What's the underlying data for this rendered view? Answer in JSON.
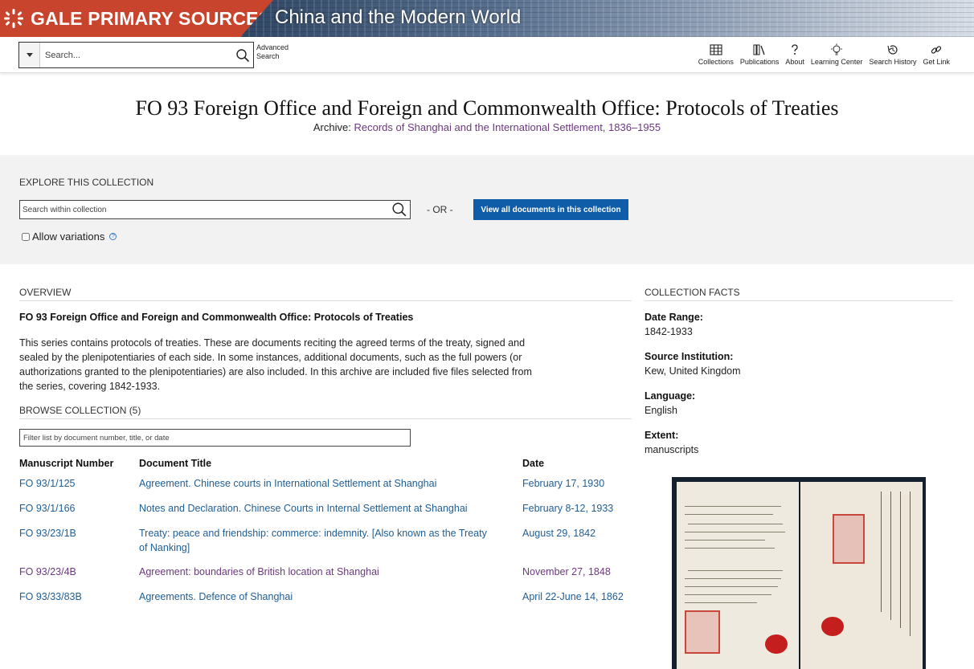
{
  "banner": {
    "brand": "GALE PRIMARY SOURCES",
    "collection": "China and the Modern World"
  },
  "toolbar": {
    "search_placeholder": "Search...",
    "advanced_line1": "Advanced",
    "advanced_line2": "Search",
    "nav": [
      "Collections",
      "Publications",
      "About",
      "Learning Center",
      "Search History",
      "Get Link"
    ]
  },
  "header": {
    "title": "FO 93 Foreign Office and Foreign and Commonwealth Office: Protocols of Treaties",
    "archive_label": "Archive:",
    "archive_link": "Records of Shanghai and the International Settlement, 1836–1955"
  },
  "explore": {
    "heading": "EXPLORE THIS COLLECTION",
    "search_placeholder": "Search within collection",
    "or": "- OR -",
    "view_all": "View all documents in this collection",
    "allow_variations": "Allow variations",
    "help": "?"
  },
  "overview": {
    "heading": "OVERVIEW",
    "title": "FO 93 Foreign Office and Foreign and Commonwealth Office: Protocols of Treaties",
    "description": "This series contains protocols of treaties. These are documents reciting the agreed terms of the treaty, signed and sealed by the plenipotentiaries of each side. In some instances, additional documents, such as the full powers (or authorizations granted to the plenipotentiaries) are also included. In this archive are included five files selected from the series, covering 1842-1933."
  },
  "browse": {
    "heading": "BROWSE COLLECTION (5)",
    "filter_placeholder": "Filter list by document number, title, or date",
    "columns": [
      "Manuscript Number",
      "Document Title",
      "Date"
    ],
    "rows": [
      {
        "number": "FO 93/1/125",
        "title": "Agreement. Chinese courts in International Settlement at Shanghai",
        "date": "February 17, 1930"
      },
      {
        "number": "FO 93/1/166",
        "title": "Notes and Declaration. Chinese Courts in Internal Settlement at Shanghai",
        "date": "February 8-12, 1933"
      },
      {
        "number": "FO 93/23/1B",
        "title": "Treaty: peace and friendship: commerce: indemnity. [Also known as the Treaty of Nanking]",
        "date": "August 29, 1842"
      },
      {
        "number": "FO 93/23/4B",
        "title": "Agreement: boundaries of British location at Shanghai",
        "date": "November 27, 1848"
      },
      {
        "number": "FO 93/33/83B",
        "title": "Agreements. Defence of Shanghai",
        "date": "April 22-June 14, 1862"
      }
    ]
  },
  "facts": {
    "heading": "COLLECTION FACTS",
    "items": [
      {
        "label": "Date Range:",
        "value": "1842-1933"
      },
      {
        "label": "Source Institution:",
        "value": "Kew, United Kingdom"
      },
      {
        "label": "Language:",
        "value": "English"
      },
      {
        "label": "Extent:",
        "value": "manuscripts"
      }
    ]
  },
  "colors": {
    "brand": "#c8442c",
    "link": "#1f5e96",
    "visited": "#6b3a7d",
    "button": "#0f5da8"
  }
}
